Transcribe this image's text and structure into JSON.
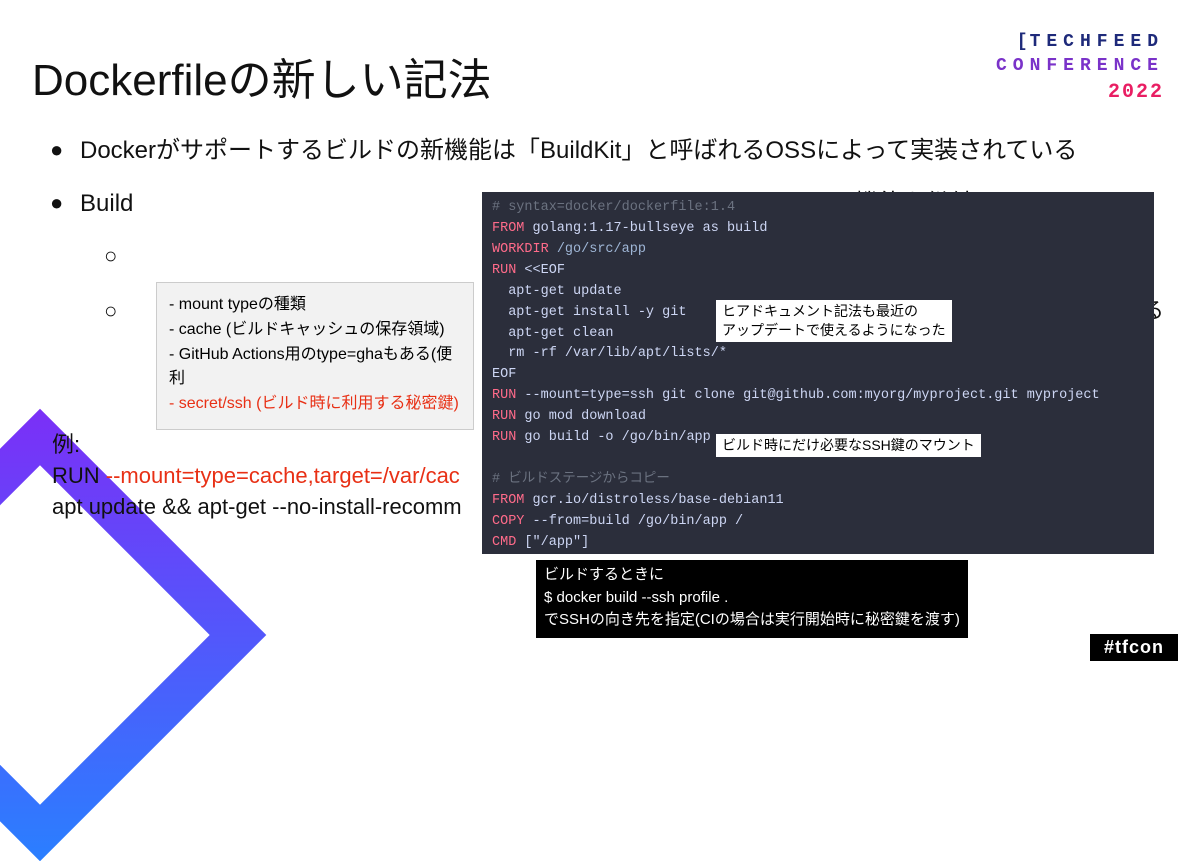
{
  "logo": {
    "line1": "TECHFEED",
    "line2": "CONFERENCE",
    "year": "2022"
  },
  "title": "Dockerfileの新しい記法",
  "bullets": {
    "b1": "Dockerがサポートするビルドの新機能は「BuildKit」と呼ばれるOSSによって実装されている",
    "b2_prefix": "Build",
    "b2_suffix": "機能を継続",
    "sub1": "",
    "sub2_suffix": "用できる"
  },
  "example": {
    "line1": "例:",
    "line2a": "RUN ",
    "line2b_red": "--mount=type=cache,target=/var/cac",
    "line3": " apt update && apt-get --no-install-recomm"
  },
  "floatbox": {
    "l1": "- mount typeの種類",
    "l2": "  - cache (ビルドキャッシュの保存領域)",
    "l3": "   - GitHub Actions用のtype=ghaもある(便利",
    "l4_red": "  - secret/ssh (ビルド時に利用する秘密鍵)"
  },
  "code": {
    "c1": "# syntax=docker/dockerfile:1.4",
    "c2a": "FROM",
    "c2b": " golang:1.17-bullseye as build",
    "c3a": "WORKDIR",
    "c3b": " /go/src/app",
    "c4a": "RUN",
    "c4b": " <<EOF",
    "c5": "  apt-get update",
    "c6": "  apt-get install -y git",
    "c7": "  apt-get clean",
    "c8": "  rm -rf /var/lib/apt/lists/*",
    "c9": "EOF",
    "c10a": "RUN",
    "c10b": " --mount=type=ssh git clone git@github.com:myorg/myproject.git myproject",
    "c11a": "RUN",
    "c11b": " go mod download",
    "c12a": "RUN",
    "c12b": " go build -o /go/bin/app",
    "c13": "",
    "c14": "# ビルドステージからコピー",
    "c15a": "FROM",
    "c15b": " gcr.io/distroless/base-debian11",
    "c16a": "COPY",
    "c16b": " --from=build /go/bin/app /",
    "c17a": "CMD",
    "c17b": " [\"/app\"]"
  },
  "callout1": "ヒアドキュメント記法も最近の\nアップデートで使えるようになった",
  "callout2": "ビルド時にだけ必要なSSH鍵のマウント",
  "bottom_note": "ビルドするときに\n$ docker build --ssh profile .\nでSSHの向き先を指定(CIの場合は実行開始時に秘密鍵を渡す)",
  "hashtag": "#tfcon"
}
